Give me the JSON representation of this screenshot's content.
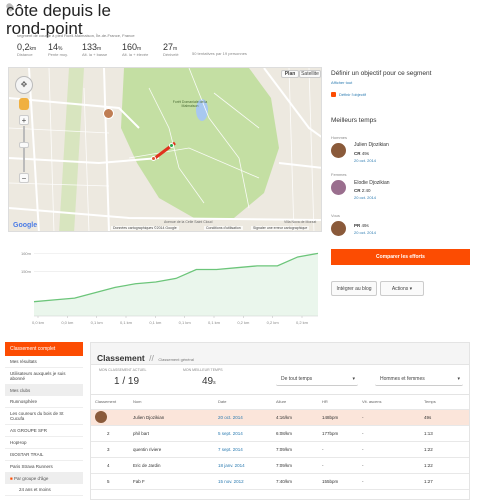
{
  "segment": {
    "title": "côte depuis le rond-point",
    "location": "segment de course à pied Rueil-Malmaison, Île-de-France, France",
    "stats": [
      {
        "value": "0,2",
        "unit": "km",
        "label": "Distance"
      },
      {
        "value": "14",
        "unit": "%",
        "label": "Pente moy."
      },
      {
        "value": "133",
        "unit": "m",
        "label": "Alt. la + basse"
      },
      {
        "value": "160",
        "unit": "m",
        "label": "Alt. la + élevée"
      },
      {
        "value": "27",
        "unit": "m",
        "label": "Dénivelé"
      },
      {
        "value": "",
        "unit": "",
        "label": "50 tentatives par 19 personnes"
      }
    ]
  },
  "map": {
    "tabs": [
      "Plan",
      "Satellite"
    ],
    "place_label": "Forêt Domaniale de la Malmaison",
    "road_label": "Avenue de la Celle Saint Cloud",
    "attribution": "Données cartographiques ©2014 Google",
    "terms": "Conditions d'utilisation",
    "report": "Signaler une erreur cartographique",
    "google": "Google",
    "villa": "Villa Nova de Morzat"
  },
  "goal": {
    "title": "Définir un objectif pour ce segment",
    "show_all": "Afficher tout",
    "define_link": "Définir l'objectif"
  },
  "best_times": {
    "title": "Meilleurs temps",
    "entries": [
      {
        "category": "Hommes",
        "name": "Julien Djozikian",
        "label": "CR",
        "time": "49s",
        "date": "20 oct. 2014"
      },
      {
        "category": "Femmes",
        "name": "Elodie Djozikian",
        "label": "CR",
        "time": "2:40",
        "date": "20 oct. 2014"
      },
      {
        "category": "Vous",
        "name": "",
        "label": "PR",
        "time": "49s",
        "date": "20 oct. 2014"
      }
    ]
  },
  "actions": {
    "compare": "Comparer les efforts",
    "embed": "Intégrer au blog",
    "actions": "Actions"
  },
  "colors": {
    "accent": "#fc4c02",
    "route": "#e0321e",
    "chart_line": "#6cc57a",
    "forest": "#c4dfa3"
  },
  "chart_data": {
    "type": "area",
    "x": [
      0,
      0.02,
      0.04,
      0.06,
      0.08,
      0.1,
      0.12,
      0.14,
      0.16,
      0.18,
      0.2,
      0.22,
      0.24,
      0.26,
      0.28
    ],
    "y": [
      133,
      134,
      135,
      138,
      141,
      143,
      144,
      146,
      151,
      151,
      152,
      153,
      153,
      158,
      160
    ],
    "x_ticks": [
      "0,0 km",
      "0,0 km",
      "0,1 km",
      "0,1 km",
      "0,1 km",
      "0,1 km",
      "0,1 km",
      "0,2 km",
      "0,2 km",
      "0,2 km"
    ],
    "y_ticks": [
      "160m",
      "150m"
    ],
    "ylim": [
      125,
      163
    ]
  },
  "leaderboard": {
    "nav": {
      "header": "Classement complet",
      "my_results": "Mes résultats",
      "following": "Utilisateurs auxquels je suis abonné",
      "clubs_title": "Mes clubs",
      "clubs": [
        "Runnosphère",
        "Les coureurs du bois de St Cucufa",
        "AS GROUPE SFR",
        "HopHop",
        "ISOSTAR TRAIL",
        "Paris Strava Runners"
      ],
      "age_title": "Par groupe d'âge",
      "age_item": "24 ans et moins"
    },
    "title": "Classement",
    "subtitle": "Classement général",
    "current_rank_label": "MON CLASSEMENT ACTUEL",
    "current_rank": "1 / 19",
    "best_time_label": "MON MEILLEUR TEMPS",
    "best_time": "49",
    "best_time_unit": "s",
    "filter_time": "De tout temps",
    "filter_gender": "Hommes et femmes",
    "columns": [
      "Classement",
      "Nom",
      "Date",
      "Allure",
      "HR",
      "Vit. ascens",
      "Temps"
    ],
    "rows": [
      {
        "rank": "1",
        "name": "Julien Djozikian",
        "date": "20 oct. 2014",
        "pace": "4:16/km",
        "hr": "148bpm",
        "vam": "-",
        "time": "49s"
      },
      {
        "rank": "2",
        "name": "phil bart",
        "date": "5 sept. 2014",
        "pace": "6:08/km",
        "hr": "177bpm",
        "vam": "-",
        "time": "1:13"
      },
      {
        "rank": "3",
        "name": "quentin riviere",
        "date": "7 sept. 2014",
        "pace": "7:09/km",
        "hr": "-",
        "vam": "-",
        "time": "1:22"
      },
      {
        "rank": "4",
        "name": "Eric de Jardin",
        "date": "18 janv. 2014",
        "pace": "7:09/km",
        "hr": "-",
        "vam": "-",
        "time": "1:22"
      },
      {
        "rank": "5",
        "name": "Fab F",
        "date": "15 nov. 2012",
        "pace": "7:40/km",
        "hr": "155bpm",
        "vam": "-",
        "time": "1:27"
      }
    ]
  }
}
